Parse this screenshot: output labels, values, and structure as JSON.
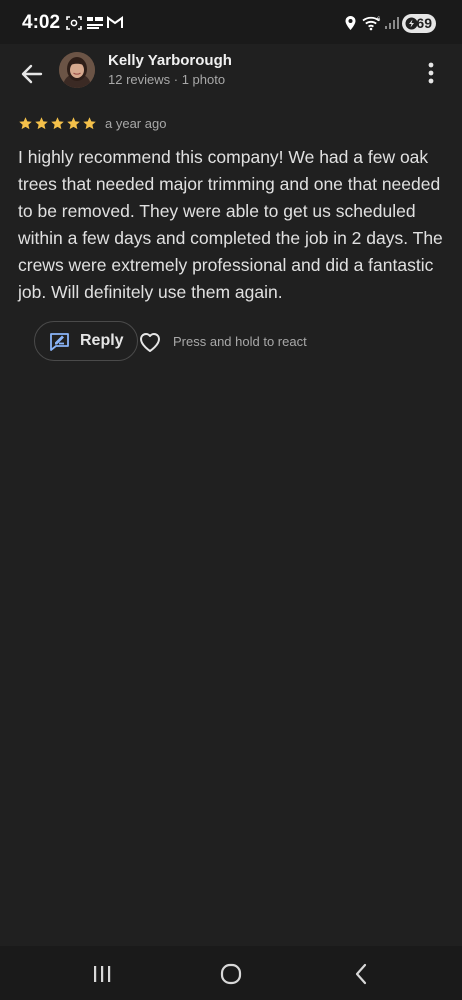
{
  "status_bar": {
    "time": "4:02",
    "battery": "69",
    "icons": [
      "screenshot-icon",
      "news-icon",
      "gmail-icon",
      "location-icon",
      "wifi-icon",
      "signal-icon",
      "battery-icon"
    ]
  },
  "header": {
    "reviewer_name": "Kelly Yarborough",
    "reviewer_meta": "12 reviews · 1 photo",
    "back_icon": "arrow-back-icon",
    "more_icon": "more-vert-icon"
  },
  "review": {
    "rating": 5,
    "rating_max": 5,
    "time_ago": "a year ago",
    "text": "I highly recommend this company! We had a few oak trees that needed major trimming and one that needed to be removed. They were able to get us scheduled within a few days and completed the job in 2 days. The crews were extremely professional and did a fantastic job. Will definitely use them again."
  },
  "actions": {
    "reply_label": "Reply",
    "react_hint": "Press and hold to react"
  },
  "colors": {
    "background": "#202020",
    "star": "#f4c04a",
    "reply_icon": "#8ab4f8",
    "text": "#e0e0e0",
    "muted": "#a8a8a8"
  },
  "nav_bar": {
    "icons": [
      "recents-icon",
      "home-icon",
      "back-nav-icon"
    ]
  }
}
